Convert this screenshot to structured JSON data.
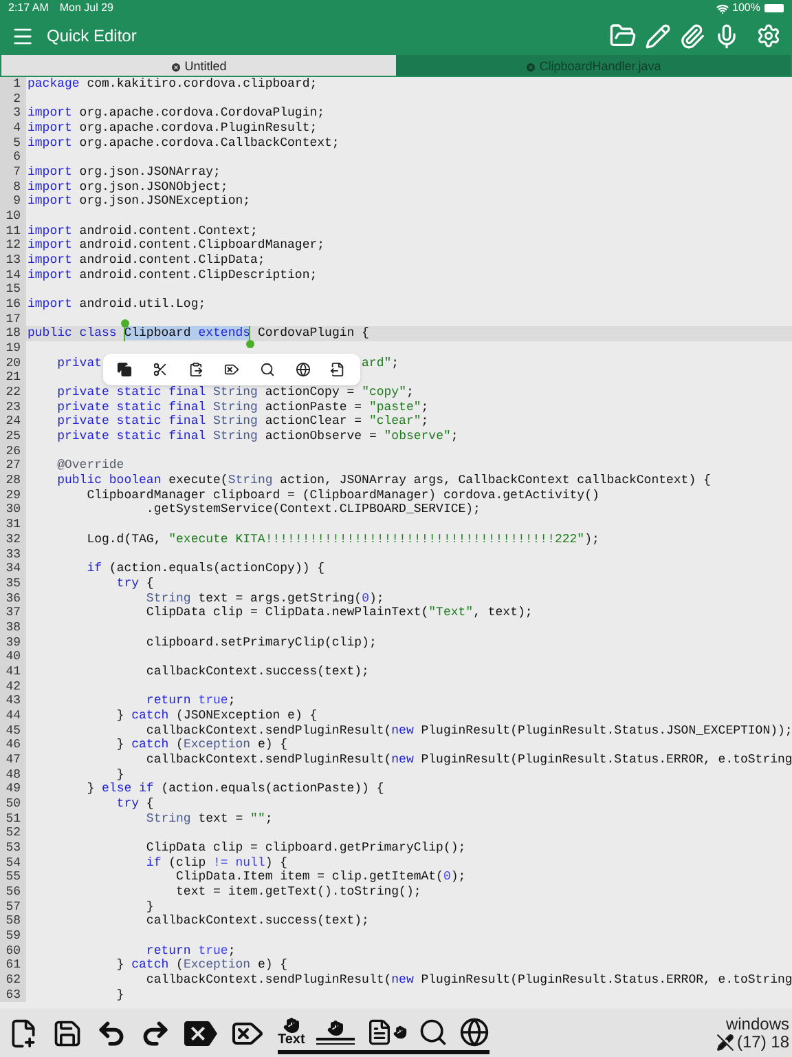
{
  "status_bar": {
    "time": "2:17 AM",
    "date": "Mon Jul 29",
    "battery": "100%"
  },
  "title_bar": {
    "title": "Quick Editor"
  },
  "tabs": [
    {
      "label": "Untitled",
      "selected": true
    },
    {
      "label": "ClipboardHandler.java",
      "selected": false
    }
  ],
  "editor": {
    "lines": [
      {
        "number": "1",
        "tokens": [
          {
            "kind": "kw",
            "text": "package"
          },
          {
            "kind": "plain",
            "text": " com.kakitiro.cordova.clipboard;"
          }
        ]
      },
      {
        "number": "2"
      },
      {
        "number": "3",
        "tokens": [
          {
            "kind": "kw",
            "text": "import"
          },
          {
            "kind": "plain",
            "text": " org.apache.cordova.CordovaPlugin;"
          }
        ]
      },
      {
        "number": "4",
        "tokens": [
          {
            "kind": "kw",
            "text": "import"
          },
          {
            "kind": "plain",
            "text": " org.apache.cordova.PluginResult;"
          }
        ]
      },
      {
        "number": "5",
        "tokens": [
          {
            "kind": "kw",
            "text": "import"
          },
          {
            "kind": "plain",
            "text": " org.apache.cordova.CallbackContext;"
          }
        ]
      },
      {
        "number": "6"
      },
      {
        "number": "7",
        "tokens": [
          {
            "kind": "kw",
            "text": "import"
          },
          {
            "kind": "plain",
            "text": " org.json.JSONArray;"
          }
        ]
      },
      {
        "number": "8",
        "tokens": [
          {
            "kind": "kw",
            "text": "import"
          },
          {
            "kind": "plain",
            "text": " org.json.JSONObject;"
          }
        ]
      },
      {
        "number": "9",
        "tokens": [
          {
            "kind": "kw",
            "text": "import"
          },
          {
            "kind": "plain",
            "text": " org.json.JSONException;"
          }
        ]
      },
      {
        "number": "10"
      },
      {
        "number": "11",
        "tokens": [
          {
            "kind": "kw",
            "text": "import"
          },
          {
            "kind": "plain",
            "text": " android.content.Context;"
          }
        ]
      },
      {
        "number": "12",
        "tokens": [
          {
            "kind": "kw",
            "text": "import"
          },
          {
            "kind": "plain",
            "text": " android.content.ClipboardManager;"
          }
        ]
      },
      {
        "number": "13",
        "tokens": [
          {
            "kind": "kw",
            "text": "import"
          },
          {
            "kind": "plain",
            "text": " android.content.ClipData;"
          }
        ]
      },
      {
        "number": "14",
        "tokens": [
          {
            "kind": "kw",
            "text": "import"
          },
          {
            "kind": "plain",
            "text": " android.content.ClipDescription;"
          }
        ]
      },
      {
        "number": "15"
      },
      {
        "number": "16",
        "tokens": [
          {
            "kind": "kw",
            "text": "import"
          },
          {
            "kind": "plain",
            "text": " android.util.Log;"
          }
        ]
      },
      {
        "number": "17"
      },
      {
        "number": "18",
        "current": true,
        "tokens": [
          {
            "kind": "kw",
            "text": "public class "
          },
          {
            "kind": "plain",
            "text": "Clipboard ",
            "selected": true
          },
          {
            "kind": "kw",
            "text": "extends",
            "selected": true
          },
          {
            "kind": "plain",
            "text": " CordovaPlugin {"
          }
        ]
      },
      {
        "number": "19"
      },
      {
        "number": "20",
        "tokens": [
          {
            "kind": "kw",
            "text": "    privat"
          }
        ],
        "tail": [
          {
            "kind": "str",
            "text": "ard\""
          },
          {
            "kind": "plain",
            "text": ";"
          }
        ]
      },
      {
        "number": "21"
      },
      {
        "number": "22",
        "tokens": [
          {
            "kind": "kw",
            "text": "    private static final "
          },
          {
            "kind": "type",
            "text": "String"
          },
          {
            "kind": "plain",
            "text": " actionCopy = "
          },
          {
            "kind": "str",
            "text": "\"copy\""
          },
          {
            "kind": "plain",
            "text": ";"
          }
        ]
      },
      {
        "number": "23",
        "tokens": [
          {
            "kind": "kw",
            "text": "    private static final "
          },
          {
            "kind": "type",
            "text": "String"
          },
          {
            "kind": "plain",
            "text": " actionPaste = "
          },
          {
            "kind": "str",
            "text": "\"paste\""
          },
          {
            "kind": "plain",
            "text": ";"
          }
        ]
      },
      {
        "number": "24",
        "tokens": [
          {
            "kind": "kw",
            "text": "    private static final "
          },
          {
            "kind": "type",
            "text": "String"
          },
          {
            "kind": "plain",
            "text": " actionClear = "
          },
          {
            "kind": "str",
            "text": "\"clear\""
          },
          {
            "kind": "plain",
            "text": ";"
          }
        ]
      },
      {
        "number": "25",
        "tokens": [
          {
            "kind": "kw",
            "text": "    private static final "
          },
          {
            "kind": "type",
            "text": "String"
          },
          {
            "kind": "plain",
            "text": " actionObserve = "
          },
          {
            "kind": "str",
            "text": "\"observe\""
          },
          {
            "kind": "plain",
            "text": ";"
          }
        ]
      },
      {
        "number": "26"
      },
      {
        "number": "27",
        "tokens": [
          {
            "kind": "anno",
            "text": "    @Override"
          }
        ]
      },
      {
        "number": "28",
        "tokens": [
          {
            "kind": "kw",
            "text": "    public boolean "
          },
          {
            "kind": "plain",
            "text": "execute("
          },
          {
            "kind": "type",
            "text": "String"
          },
          {
            "kind": "plain",
            "text": " action, JSONArray args, CallbackContext callbackContext) {"
          }
        ]
      },
      {
        "number": "29",
        "tokens": [
          {
            "kind": "plain",
            "text": "        ClipboardManager clipboard = (ClipboardManager) cordova.getActivity()"
          }
        ]
      },
      {
        "number": "30",
        "tokens": [
          {
            "kind": "plain",
            "text": "                .getSystemService(Context.CLIPBOARD_SERVICE);"
          }
        ]
      },
      {
        "number": "31"
      },
      {
        "number": "32",
        "tokens": [
          {
            "kind": "plain",
            "text": "        Log.d(TAG, "
          },
          {
            "kind": "str",
            "text": "\"execute KITA!!!!!!!!!!!!!!!!!!!!!!!!!!!!!!!!!!!!!!!222\""
          },
          {
            "kind": "plain",
            "text": ");"
          }
        ]
      },
      {
        "number": "33"
      },
      {
        "number": "34",
        "tokens": [
          {
            "kind": "kw",
            "text": "        if"
          },
          {
            "kind": "plain",
            "text": " (action.equals(actionCopy)) {"
          }
        ]
      },
      {
        "number": "35",
        "tokens": [
          {
            "kind": "kw",
            "text": "            try"
          },
          {
            "kind": "plain",
            "text": " {"
          }
        ]
      },
      {
        "number": "36",
        "tokens": [
          {
            "kind": "type",
            "text": "                String"
          },
          {
            "kind": "plain",
            "text": " text = args.getString("
          },
          {
            "kind": "num",
            "text": "0"
          },
          {
            "kind": "plain",
            "text": ");"
          }
        ]
      },
      {
        "number": "37",
        "tokens": [
          {
            "kind": "plain",
            "text": "                ClipData clip = ClipData.newPlainText("
          },
          {
            "kind": "str",
            "text": "\"Text\""
          },
          {
            "kind": "plain",
            "text": ", text);"
          }
        ]
      },
      {
        "number": "38"
      },
      {
        "number": "39",
        "tokens": [
          {
            "kind": "plain",
            "text": "                clipboard.setPrimaryClip(clip);"
          }
        ]
      },
      {
        "number": "40"
      },
      {
        "number": "41",
        "tokens": [
          {
            "kind": "plain",
            "text": "                callbackContext.success(text);"
          }
        ]
      },
      {
        "number": "42"
      },
      {
        "number": "43",
        "tokens": [
          {
            "kind": "kw",
            "text": "                return "
          },
          {
            "kind": "num",
            "text": "true"
          },
          {
            "kind": "plain",
            "text": ";"
          }
        ]
      },
      {
        "number": "44",
        "tokens": [
          {
            "kind": "plain",
            "text": "            } "
          },
          {
            "kind": "kw",
            "text": "catch"
          },
          {
            "kind": "plain",
            "text": " (JSONException e) {"
          }
        ]
      },
      {
        "number": "45",
        "tokens": [
          {
            "kind": "plain",
            "text": "                callbackContext.sendPluginResult("
          },
          {
            "kind": "kw",
            "text": "new"
          },
          {
            "kind": "plain",
            "text": " PluginResult(PluginResult.Status.JSON_EXCEPTION));"
          }
        ]
      },
      {
        "number": "46",
        "tokens": [
          {
            "kind": "plain",
            "text": "            } "
          },
          {
            "kind": "kw",
            "text": "catch"
          },
          {
            "kind": "plain",
            "text": " ("
          },
          {
            "kind": "type",
            "text": "Exception"
          },
          {
            "kind": "plain",
            "text": " e) {"
          }
        ]
      },
      {
        "number": "47",
        "tokens": [
          {
            "kind": "plain",
            "text": "                callbackContext.sendPluginResult("
          },
          {
            "kind": "kw",
            "text": "new"
          },
          {
            "kind": "plain",
            "text": " PluginResult(PluginResult.Status.ERROR, e.toString"
          }
        ]
      },
      {
        "number": "48",
        "tokens": [
          {
            "kind": "plain",
            "text": "            }"
          }
        ]
      },
      {
        "number": "49",
        "tokens": [
          {
            "kind": "plain",
            "text": "        } "
          },
          {
            "kind": "kw",
            "text": "else if"
          },
          {
            "kind": "plain",
            "text": " (action.equals(actionPaste)) {"
          }
        ]
      },
      {
        "number": "50",
        "tokens": [
          {
            "kind": "kw",
            "text": "            try"
          },
          {
            "kind": "plain",
            "text": " {"
          }
        ]
      },
      {
        "number": "51",
        "tokens": [
          {
            "kind": "type",
            "text": "                String"
          },
          {
            "kind": "plain",
            "text": " text = "
          },
          {
            "kind": "str",
            "text": "\"\""
          },
          {
            "kind": "plain",
            "text": ";"
          }
        ]
      },
      {
        "number": "52"
      },
      {
        "number": "53",
        "tokens": [
          {
            "kind": "plain",
            "text": "                ClipData clip = clipboard.getPrimaryClip();"
          }
        ]
      },
      {
        "number": "54",
        "tokens": [
          {
            "kind": "kw",
            "text": "                if"
          },
          {
            "kind": "plain",
            "text": " (clip "
          },
          {
            "kind": "num",
            "text": "!= null"
          },
          {
            "kind": "plain",
            "text": ") {"
          }
        ]
      },
      {
        "number": "55",
        "tokens": [
          {
            "kind": "plain",
            "text": "                    ClipData.Item item = clip.getItemAt("
          },
          {
            "kind": "num",
            "text": "0"
          },
          {
            "kind": "plain",
            "text": ");"
          }
        ]
      },
      {
        "number": "56",
        "tokens": [
          {
            "kind": "plain",
            "text": "                    text = item.getText().toString();"
          }
        ]
      },
      {
        "number": "57",
        "tokens": [
          {
            "kind": "plain",
            "text": "                }"
          }
        ]
      },
      {
        "number": "58",
        "tokens": [
          {
            "kind": "plain",
            "text": "                callbackContext.success(text);"
          }
        ]
      },
      {
        "number": "59"
      },
      {
        "number": "60",
        "tokens": [
          {
            "kind": "kw",
            "text": "                return "
          },
          {
            "kind": "num",
            "text": "true"
          },
          {
            "kind": "plain",
            "text": ";"
          }
        ]
      },
      {
        "number": "61",
        "tokens": [
          {
            "kind": "plain",
            "text": "            } "
          },
          {
            "kind": "kw",
            "text": "catch"
          },
          {
            "kind": "plain",
            "text": " ("
          },
          {
            "kind": "type",
            "text": "Exception"
          },
          {
            "kind": "plain",
            "text": " e) {"
          }
        ]
      },
      {
        "number": "62",
        "tokens": [
          {
            "kind": "plain",
            "text": "                callbackContext.sendPluginResult("
          },
          {
            "kind": "kw",
            "text": "new"
          },
          {
            "kind": "plain",
            "text": " PluginResult(PluginResult.Status.ERROR, e.toString"
          }
        ]
      },
      {
        "number": "63",
        "tokens": [
          {
            "kind": "plain",
            "text": "            }"
          }
        ]
      }
    ]
  },
  "toolbar": {
    "text_tool_label": "Text"
  },
  "doc_status": {
    "encoding": "windows",
    "position": "(17) 18"
  }
}
